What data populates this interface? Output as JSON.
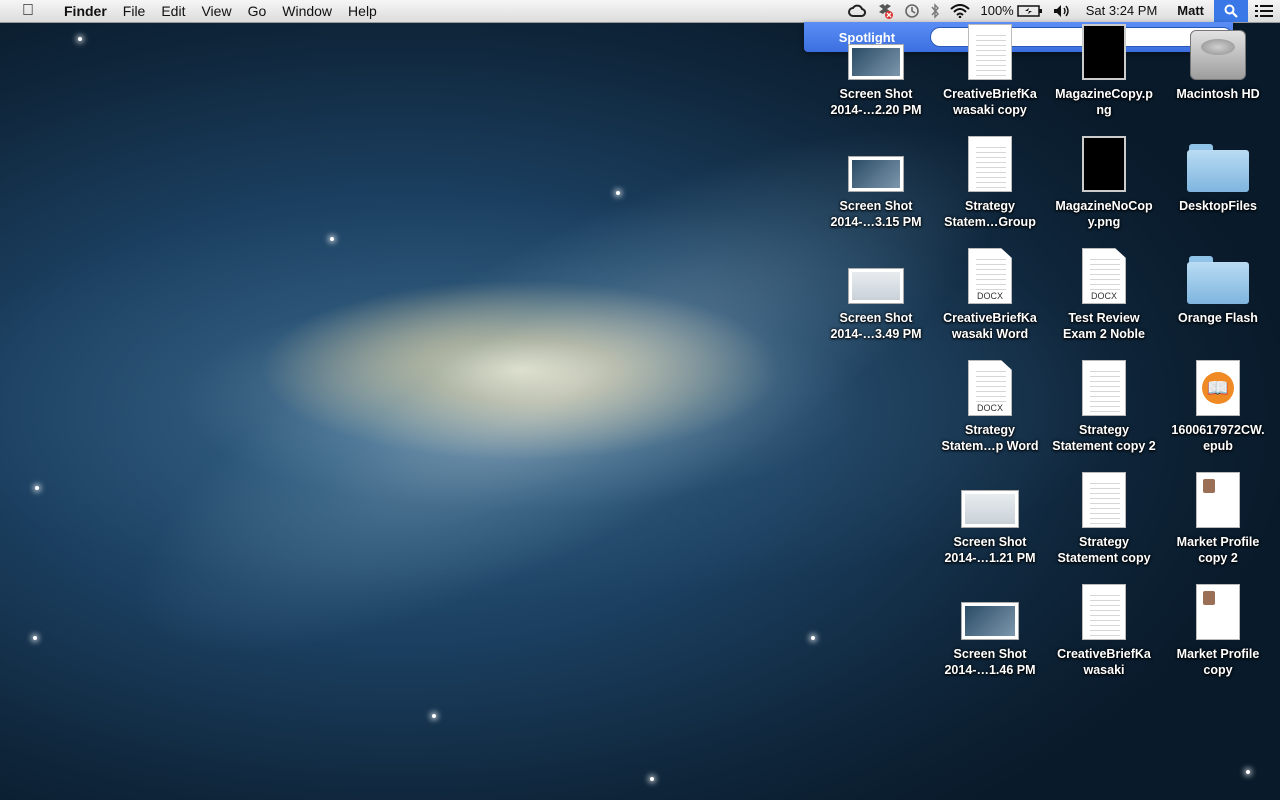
{
  "menubar": {
    "apple_icon": "apple-icon",
    "app_name": "Finder",
    "menus": [
      "File",
      "Edit",
      "View",
      "Go",
      "Window",
      "Help"
    ],
    "battery": "100%",
    "clock": "Sat 3:24 PM",
    "user": "Matt",
    "accent_color": "#3b78e7"
  },
  "spotlight": {
    "label": "Spotlight",
    "query": "",
    "placeholder": ""
  },
  "desktop": {
    "icons": [
      {
        "name": "Screen Shot\n2014-…2.20 PM",
        "kind": "screenshot"
      },
      {
        "name": "CreativeBriefKa\nwasaki copy",
        "kind": "document"
      },
      {
        "name": "MagazineCopy.p\nng",
        "kind": "image"
      },
      {
        "name": "Macintosh HD",
        "kind": "drive"
      },
      {
        "name": "Screen Shot\n2014-…3.15 PM",
        "kind": "screenshot"
      },
      {
        "name": "Strategy\nStatem…Group",
        "kind": "document"
      },
      {
        "name": "MagazineNoCop\ny.png",
        "kind": "image"
      },
      {
        "name": "DesktopFiles",
        "kind": "folder"
      },
      {
        "name": "Screen Shot\n2014-…3.49 PM",
        "kind": "screenshot"
      },
      {
        "name": "CreativeBriefKa\nwasaki Word",
        "kind": "docx"
      },
      {
        "name": "Test Review\nExam 2 Noble",
        "kind": "docx"
      },
      {
        "name": "Orange Flash",
        "kind": "folder"
      },
      {
        "name": "Strategy\nStatem…p Word",
        "kind": "docx"
      },
      {
        "name": "Strategy\nStatement copy 2",
        "kind": "document"
      },
      {
        "name": "1600617972CW.\nepub",
        "kind": "epub"
      },
      {
        "name": "Screen Shot\n2014-…1.21 PM",
        "kind": "screenshot"
      },
      {
        "name": "Strategy\nStatement copy",
        "kind": "document"
      },
      {
        "name": "Market Profile\ncopy 2",
        "kind": "profile"
      },
      {
        "name": "Screen Shot\n2014-…1.46 PM",
        "kind": "screenshot"
      },
      {
        "name": "CreativeBriefKa\nwasaki",
        "kind": "document"
      },
      {
        "name": "Market Profile\ncopy",
        "kind": "profile"
      }
    ],
    "docx_tag": "DOCX"
  }
}
